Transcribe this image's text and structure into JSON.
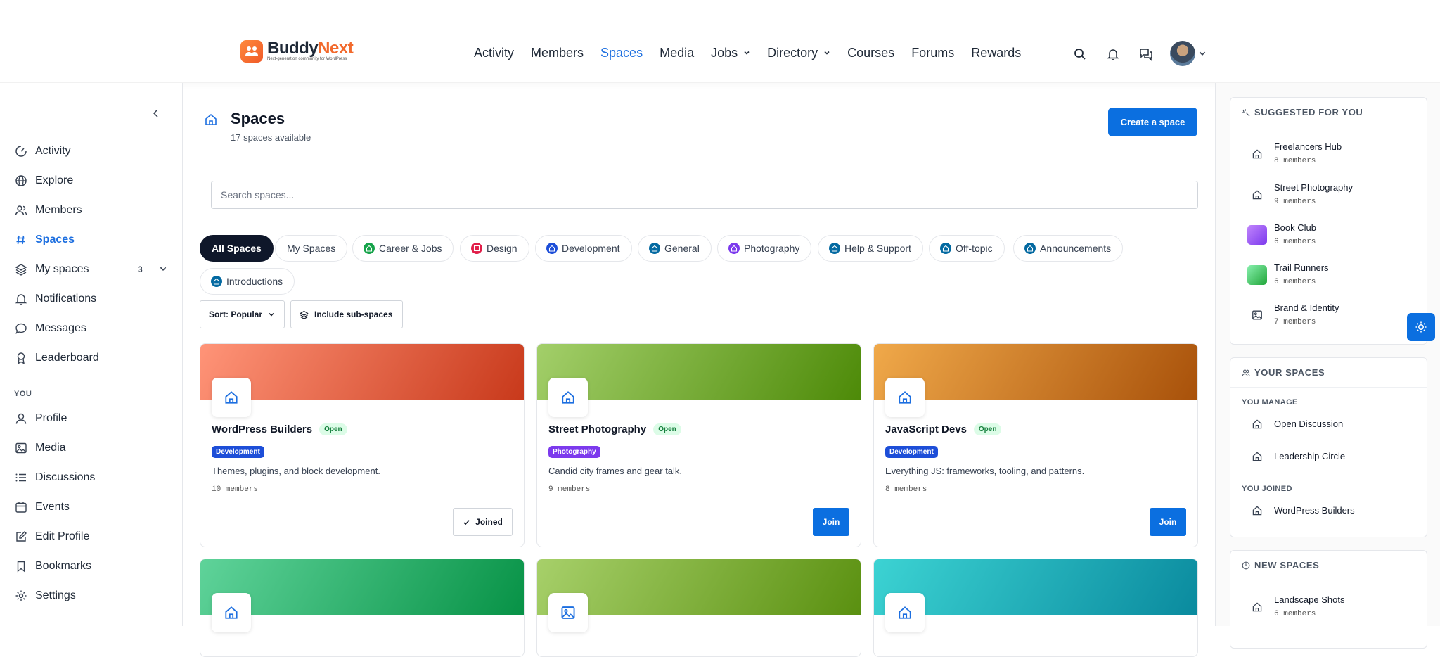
{
  "brand": {
    "name_dark": "Buddy",
    "name_accent": "Next",
    "tagline": "Next-generation community for WordPress"
  },
  "nav": {
    "items": [
      {
        "label": "Activity",
        "active": false,
        "dropdown": false
      },
      {
        "label": "Members",
        "active": false,
        "dropdown": false
      },
      {
        "label": "Spaces",
        "active": true,
        "dropdown": false
      },
      {
        "label": "Media",
        "active": false,
        "dropdown": false
      },
      {
        "label": "Jobs",
        "active": false,
        "dropdown": true
      },
      {
        "label": "Directory",
        "active": false,
        "dropdown": true
      },
      {
        "label": "Courses",
        "active": false,
        "dropdown": false
      },
      {
        "label": "Forums",
        "active": false,
        "dropdown": false
      },
      {
        "label": "Rewards",
        "active": false,
        "dropdown": false
      }
    ],
    "icons": [
      "search-icon",
      "bell-icon",
      "messages-icon",
      "avatar"
    ]
  },
  "sidebar": {
    "items": [
      {
        "label": "Activity",
        "icon": "activity-icon"
      },
      {
        "label": "Explore",
        "icon": "globe-icon"
      },
      {
        "label": "Members",
        "icon": "members-icon"
      },
      {
        "label": "Spaces",
        "icon": "hash-icon",
        "active": true
      },
      {
        "label": "My spaces",
        "icon": "layers-icon",
        "badge": "3"
      },
      {
        "label": "Notifications",
        "icon": "bell-icon"
      },
      {
        "label": "Messages",
        "icon": "chat-icon"
      },
      {
        "label": "Leaderboard",
        "icon": "award-icon"
      }
    ],
    "you_heading": "YOU",
    "you_items": [
      {
        "label": "Profile",
        "icon": "user-icon"
      },
      {
        "label": "Media",
        "icon": "image-icon"
      },
      {
        "label": "Discussions",
        "icon": "list-icon"
      },
      {
        "label": "Events",
        "icon": "calendar-icon"
      },
      {
        "label": "Edit Profile",
        "icon": "edit-icon"
      },
      {
        "label": "Bookmarks",
        "icon": "bookmark-icon"
      },
      {
        "label": "Settings",
        "icon": "gear-icon"
      }
    ]
  },
  "page": {
    "title": "Spaces",
    "subtitle": "17 spaces available",
    "create_label": "Create a space",
    "search_placeholder": "Search spaces...",
    "sort_label": "Sort: Popular",
    "subspaces_label": "Include sub-spaces"
  },
  "filters": [
    {
      "label": "All Spaces",
      "active": true
    },
    {
      "label": "My Spaces"
    },
    {
      "label": "Career & Jobs",
      "color": "#16a34a"
    },
    {
      "label": "Design",
      "color": "#e11d48"
    },
    {
      "label": "Development",
      "color": "#1d4ed8"
    },
    {
      "label": "General",
      "color": "#0369a1"
    },
    {
      "label": "Photography",
      "color": "#7c3aed"
    },
    {
      "label": "Help & Support",
      "color": "#0369a1"
    },
    {
      "label": "Off-topic",
      "color": "#0369a1"
    },
    {
      "label": "Announcements",
      "color": "#0369a1"
    },
    {
      "label": "Introductions",
      "color": "#0369a1"
    }
  ],
  "cards": [
    {
      "name": "WordPress Builders",
      "status": "Open",
      "category": "Development",
      "category_color": "#1d4ed8",
      "description": "Themes, plugins, and block development.",
      "members": "10 members",
      "action": "Joined",
      "gradient": [
        "#ff9478",
        "#c8391b"
      ],
      "icon": "home-icon"
    },
    {
      "name": "Street Photography",
      "status": "Open",
      "category": "Photography",
      "category_color": "#7c3aed",
      "description": "Candid city frames and gear talk.",
      "members": "9 members",
      "action": "Join",
      "gradient": [
        "#a3cf6a",
        "#4d8a08"
      ],
      "icon": "home-icon"
    },
    {
      "name": "JavaScript Devs",
      "status": "Open",
      "category": "Development",
      "category_color": "#1d4ed8",
      "description": "Everything JS: frameworks, tooling, and patterns.",
      "members": "8 members",
      "action": "Join",
      "gradient": [
        "#f0a94a",
        "#a8510a"
      ],
      "icon": "home-icon"
    },
    {
      "gradient": [
        "#5fd39a",
        "#079246"
      ],
      "icon": "home-icon"
    },
    {
      "gradient": [
        "#a7d06a",
        "#5a9010"
      ],
      "icon": "image-icon"
    },
    {
      "gradient": [
        "#3cd3d3",
        "#0a8a9e"
      ],
      "icon": "home-icon"
    }
  ],
  "right": {
    "suggested_heading": "SUGGESTED FOR YOU",
    "suggested": [
      {
        "name": "Freelancers Hub",
        "members": "8 members",
        "thumb": "home"
      },
      {
        "name": "Street Photography",
        "members": "9 members",
        "thumb": "home"
      },
      {
        "name": "Book Club",
        "members": "6 members",
        "thumb": "purple"
      },
      {
        "name": "Trail Runners",
        "members": "6 members",
        "thumb": "green"
      },
      {
        "name": "Brand & Identity",
        "members": "7 members",
        "thumb": "image"
      }
    ],
    "your_heading": "YOUR SPACES",
    "manage_heading": "YOU MANAGE",
    "manage": [
      "Open Discussion",
      "Leadership Circle"
    ],
    "joined_heading": "YOU JOINED",
    "joined": [
      "WordPress Builders"
    ],
    "new_heading": "NEW SPACES",
    "new_spaces": [
      {
        "name": "Landscape Shots",
        "members": "6 members"
      }
    ]
  },
  "colors": {
    "accent": "#0b6fe0",
    "brand_orange": "#f26a2d",
    "dark_chip": "#0f172a"
  }
}
